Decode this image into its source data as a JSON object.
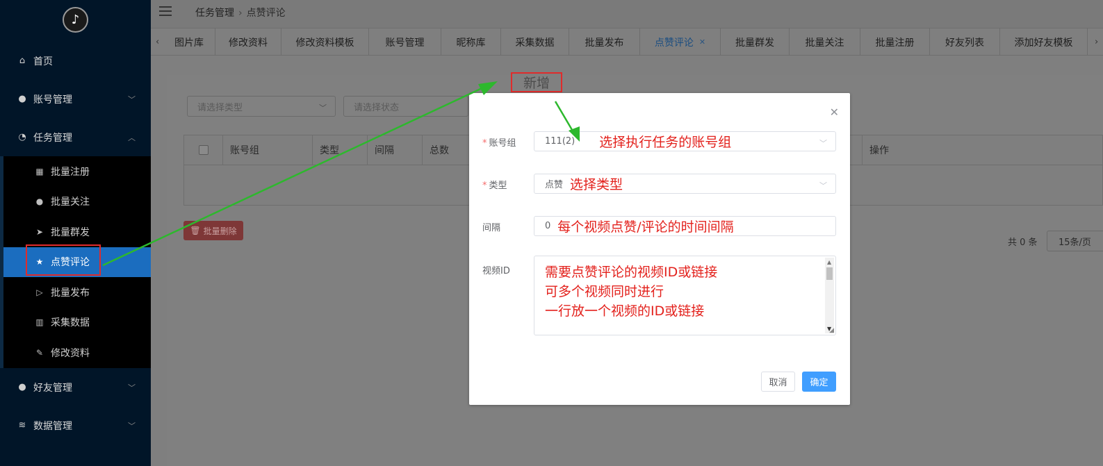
{
  "sidebar": {
    "logo_icon": "tiktok-icon",
    "menu": [
      {
        "label": "首页",
        "icon": "home-icon"
      },
      {
        "label": "账号管理",
        "icon": "user-icon",
        "chevron": "chevron-down-icon"
      },
      {
        "label": "任务管理",
        "icon": "timer-icon",
        "chevron": "chevron-up-icon"
      },
      {
        "label": "好友管理",
        "icon": "user-icon",
        "chevron": "chevron-down-icon"
      },
      {
        "label": "数据管理",
        "icon": "database-icon",
        "chevron": "chevron-down-icon"
      }
    ],
    "submenu": [
      {
        "label": "批量注册",
        "icon": "building-icon"
      },
      {
        "label": "批量关注",
        "icon": "user-icon"
      },
      {
        "label": "批量群发",
        "icon": "send-icon"
      },
      {
        "label": "点赞评论",
        "icon": "star-icon",
        "active": true
      },
      {
        "label": "批量发布",
        "icon": "play-circle-icon"
      },
      {
        "label": "采集数据",
        "icon": "chart-icon"
      },
      {
        "label": "修改资料",
        "icon": "edit-icon"
      }
    ]
  },
  "header": {
    "breadcrumb": [
      "任务管理",
      "点赞评论"
    ]
  },
  "tabs": [
    {
      "label": "图片库"
    },
    {
      "label": "修改资料"
    },
    {
      "label": "修改资料模板"
    },
    {
      "label": "账号管理"
    },
    {
      "label": "昵称库"
    },
    {
      "label": "采集数据"
    },
    {
      "label": "批量发布"
    },
    {
      "label": "点赞评论",
      "active": true
    },
    {
      "label": "批量群发"
    },
    {
      "label": "批量关注"
    },
    {
      "label": "批量注册"
    },
    {
      "label": "好友列表"
    },
    {
      "label": "添加好友模板"
    }
  ],
  "filters": {
    "type_placeholder": "请选择类型",
    "status_placeholder": "请选择状态"
  },
  "table": {
    "columns": [
      "账号组",
      "类型",
      "间隔",
      "总数",
      "操作"
    ]
  },
  "toolbar": {
    "bulk_delete_label": "批量删除"
  },
  "pagination": {
    "total": "共 0 条",
    "page_size": "15条/页"
  },
  "annotation": {
    "add_label": "新增"
  },
  "dialog": {
    "account_group": {
      "label": "账号组",
      "value": "111(2)",
      "note": "选择执行任务的账号组"
    },
    "type": {
      "label": "类型",
      "value": "点赞",
      "note": "选择类型"
    },
    "interval": {
      "label": "间隔",
      "value": "0",
      "note": "每个视频点赞/评论的时间间隔"
    },
    "video_id": {
      "label": "视频ID",
      "lines": [
        "需要点赞评论的视频ID或链接",
        "可多个视频同时进行",
        "一行放一个视频的ID或链接"
      ]
    },
    "cancel_label": "取消",
    "ok_label": "确定"
  },
  "colors": {
    "primary": "#409eff",
    "annotation_red": "#e3211c",
    "arrow_green": "#2db82d",
    "sidebar_bg": "#011528",
    "active_menu": "#1b6dbf"
  }
}
